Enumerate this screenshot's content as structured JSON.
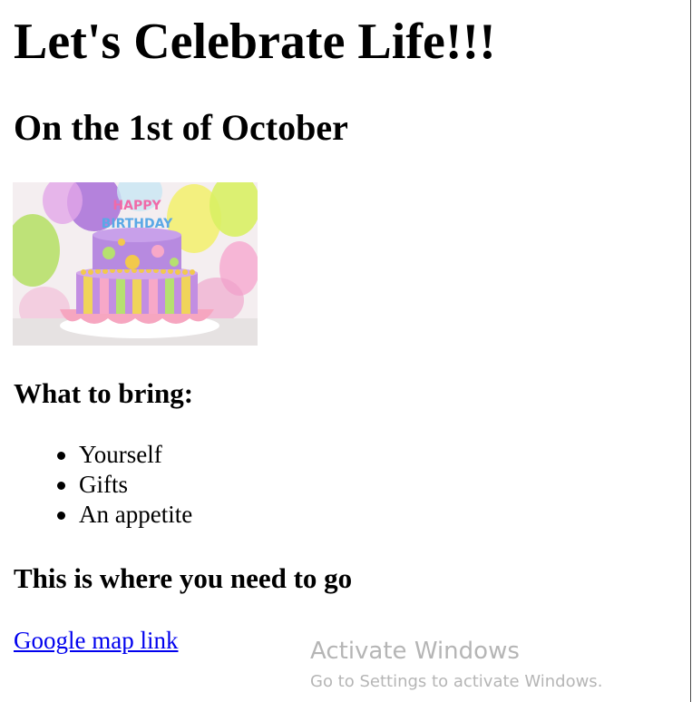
{
  "page": {
    "title": "Let's Celebrate Life!!!",
    "date_heading": "On the 1st of October",
    "image_alt": "Happy Birthday cake",
    "cake_topper": {
      "line1": "HAPPY",
      "line2": "BIRTHDAY"
    },
    "bring_heading": "What to bring:",
    "bring_items": [
      {
        "label": "Yourself"
      },
      {
        "label": "Gifts"
      },
      {
        "label": "An appetite"
      }
    ],
    "directions_heading": "This is where you need to go",
    "map_link_label": "Google map link"
  },
  "watermark": {
    "title": "Activate Windows",
    "subtitle": "Go to Settings to activate Windows."
  },
  "colors": {
    "link": "#0000ee",
    "text": "#000000",
    "background": "#ffffff"
  }
}
